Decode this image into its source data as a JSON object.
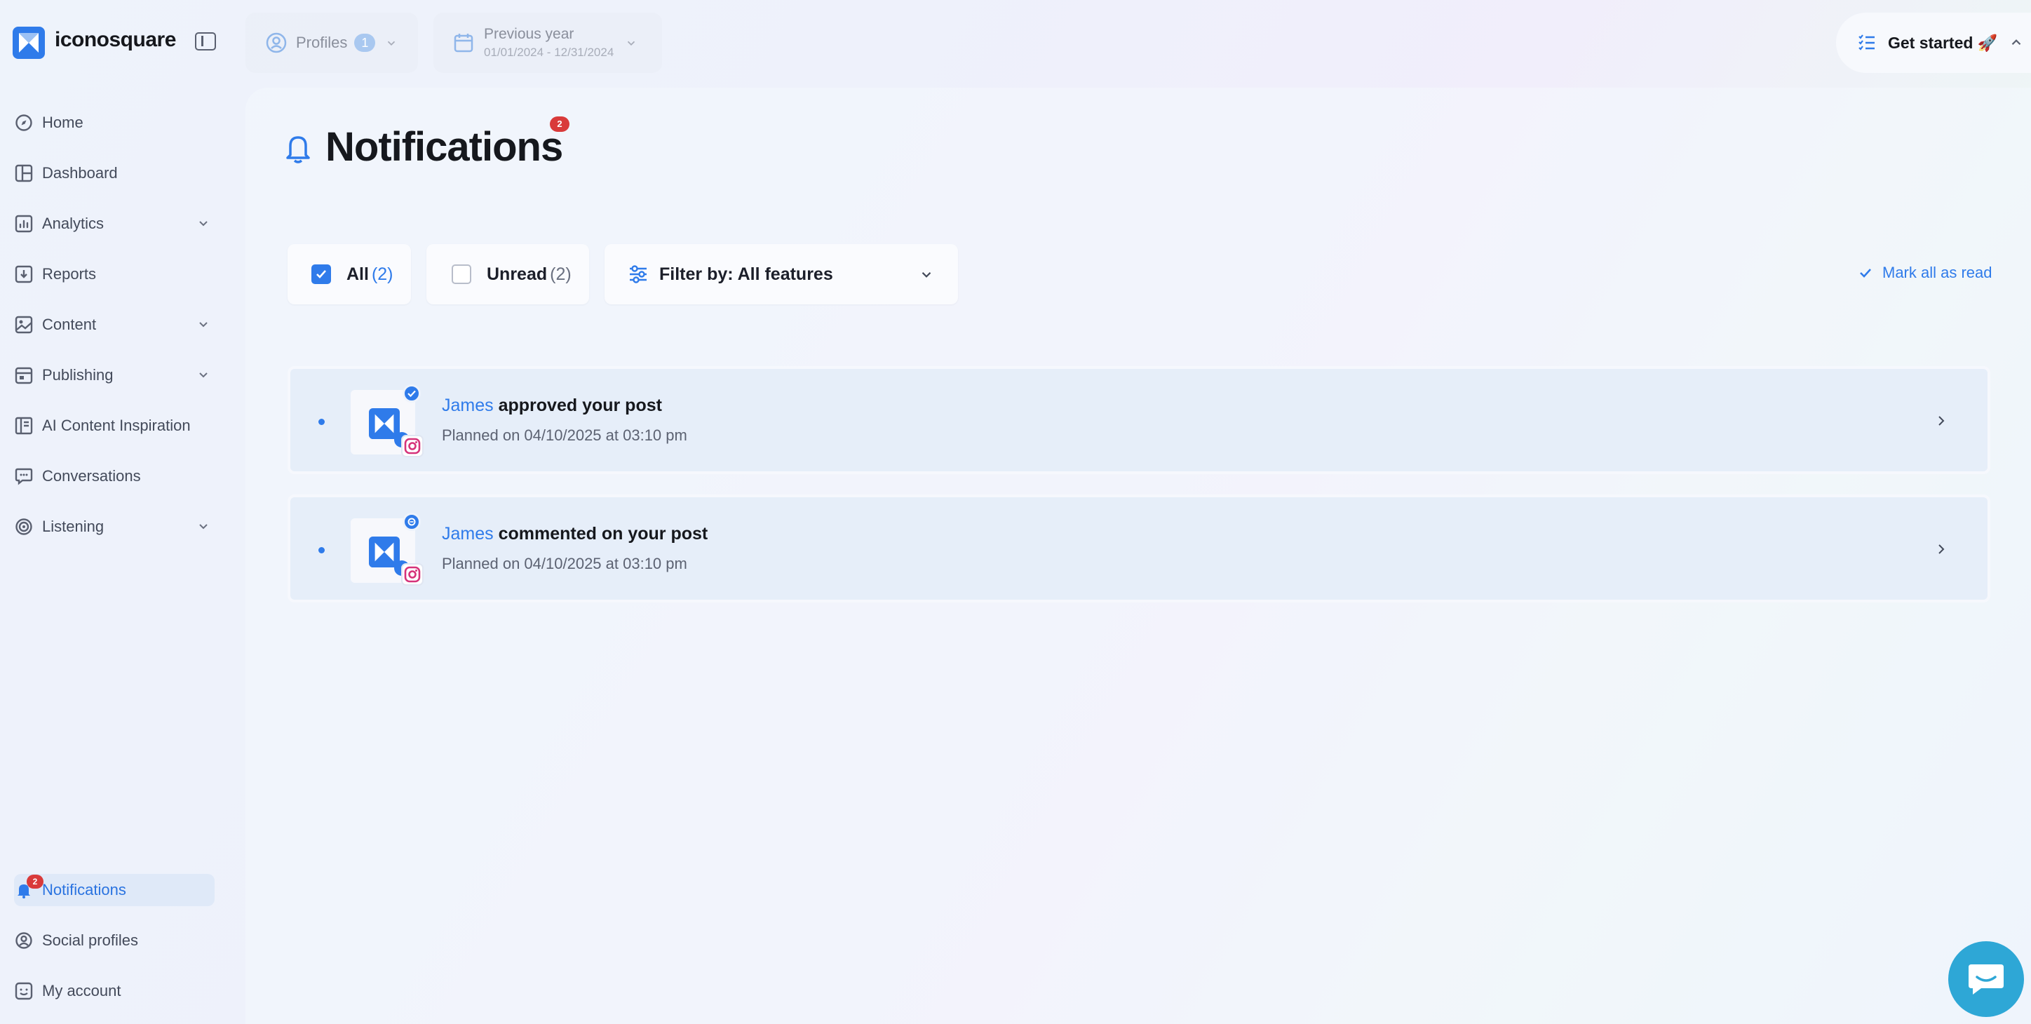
{
  "app": {
    "name": "iconosquare"
  },
  "sidebar": {
    "items": [
      {
        "label": "Home",
        "icon": "compass-icon"
      },
      {
        "label": "Dashboard",
        "icon": "dashboard-icon"
      },
      {
        "label": "Analytics",
        "icon": "chart-icon",
        "expandable": true
      },
      {
        "label": "Reports",
        "icon": "download-icon"
      },
      {
        "label": "Content",
        "icon": "image-icon",
        "expandable": true
      },
      {
        "label": "Publishing",
        "icon": "calendar-icon",
        "expandable": true
      },
      {
        "label": "AI Content Inspiration",
        "icon": "book-icon"
      },
      {
        "label": "Conversations",
        "icon": "chat-bubble-icon"
      },
      {
        "label": "Listening",
        "icon": "radar-icon",
        "expandable": true
      }
    ],
    "bottom": [
      {
        "label": "Notifications",
        "icon": "bell-icon",
        "badge": "2",
        "active": true
      },
      {
        "label": "Social profiles",
        "icon": "user-circle-icon"
      },
      {
        "label": "My account",
        "icon": "smile-icon"
      }
    ]
  },
  "topbar": {
    "profiles_label": "Profiles",
    "profiles_count": "1",
    "period_label": "Previous year",
    "period_range": "01/01/2024 - 12/31/2024",
    "get_started_label": "Get started 🚀"
  },
  "page": {
    "title": "Notifications",
    "title_badge": "2",
    "filters": {
      "all_label": "All",
      "all_count": "(2)",
      "unread_label": "Unread",
      "unread_count": "(2)",
      "filter_by_label": "Filter by: All features"
    },
    "mark_all_label": "Mark all as read",
    "notifications": [
      {
        "actor": "James",
        "action": "approved your post",
        "detail": "Planned on 04/10/2025 at 03:10 pm",
        "status_icon": "check-icon"
      },
      {
        "actor": "James",
        "action": "commented on your post",
        "detail": "Planned on 04/10/2025 at 03:10 pm",
        "status_icon": "comment-icon"
      }
    ]
  },
  "colors": {
    "accent": "#2f7bea",
    "badge": "#d93a3a",
    "chat": "#2ea7d6"
  }
}
